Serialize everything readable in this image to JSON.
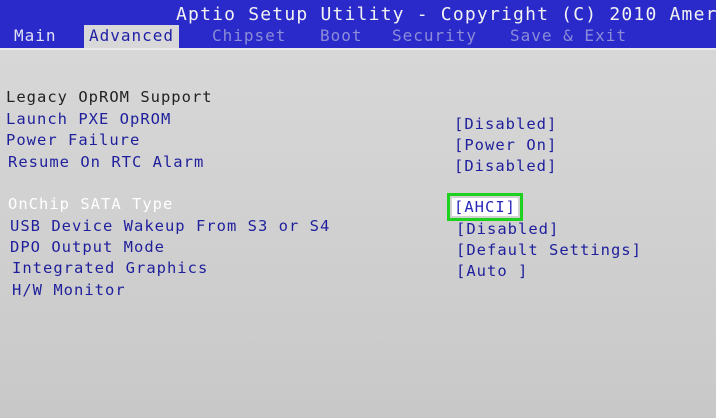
{
  "header": {
    "title": "Aptio Setup Utility - Copyright (C) 2010 Amer",
    "tabs": [
      "Main",
      "Advanced",
      "Chipset",
      "Boot",
      "Security",
      "Save & Exit"
    ],
    "active_tab": "Advanced"
  },
  "settings": {
    "section_heading": "Legacy OpROM Support",
    "items": [
      {
        "label": "Launch PXE OpROM",
        "value": "[Disabled]"
      },
      {
        "label": "Power Failure",
        "value": "[Power On]"
      },
      {
        "label": "Resume On RTC Alarm",
        "value": "[Disabled]"
      },
      {
        "label": "OnChip SATA Type",
        "value": "[AHCI]"
      },
      {
        "label": "USB Device Wakeup From S3 or S4",
        "value": "[Disabled]"
      },
      {
        "label": "DPO Output Mode",
        "value": "[Default Settings]"
      },
      {
        "label": "Integrated Graphics",
        "value": "[Auto ]"
      },
      {
        "label": "H/W Monitor",
        "value": ""
      }
    ]
  },
  "colors": {
    "header_bg": "#2a2acb",
    "text_blue": "#1f1f9c",
    "highlight_border": "#1fd11f"
  }
}
